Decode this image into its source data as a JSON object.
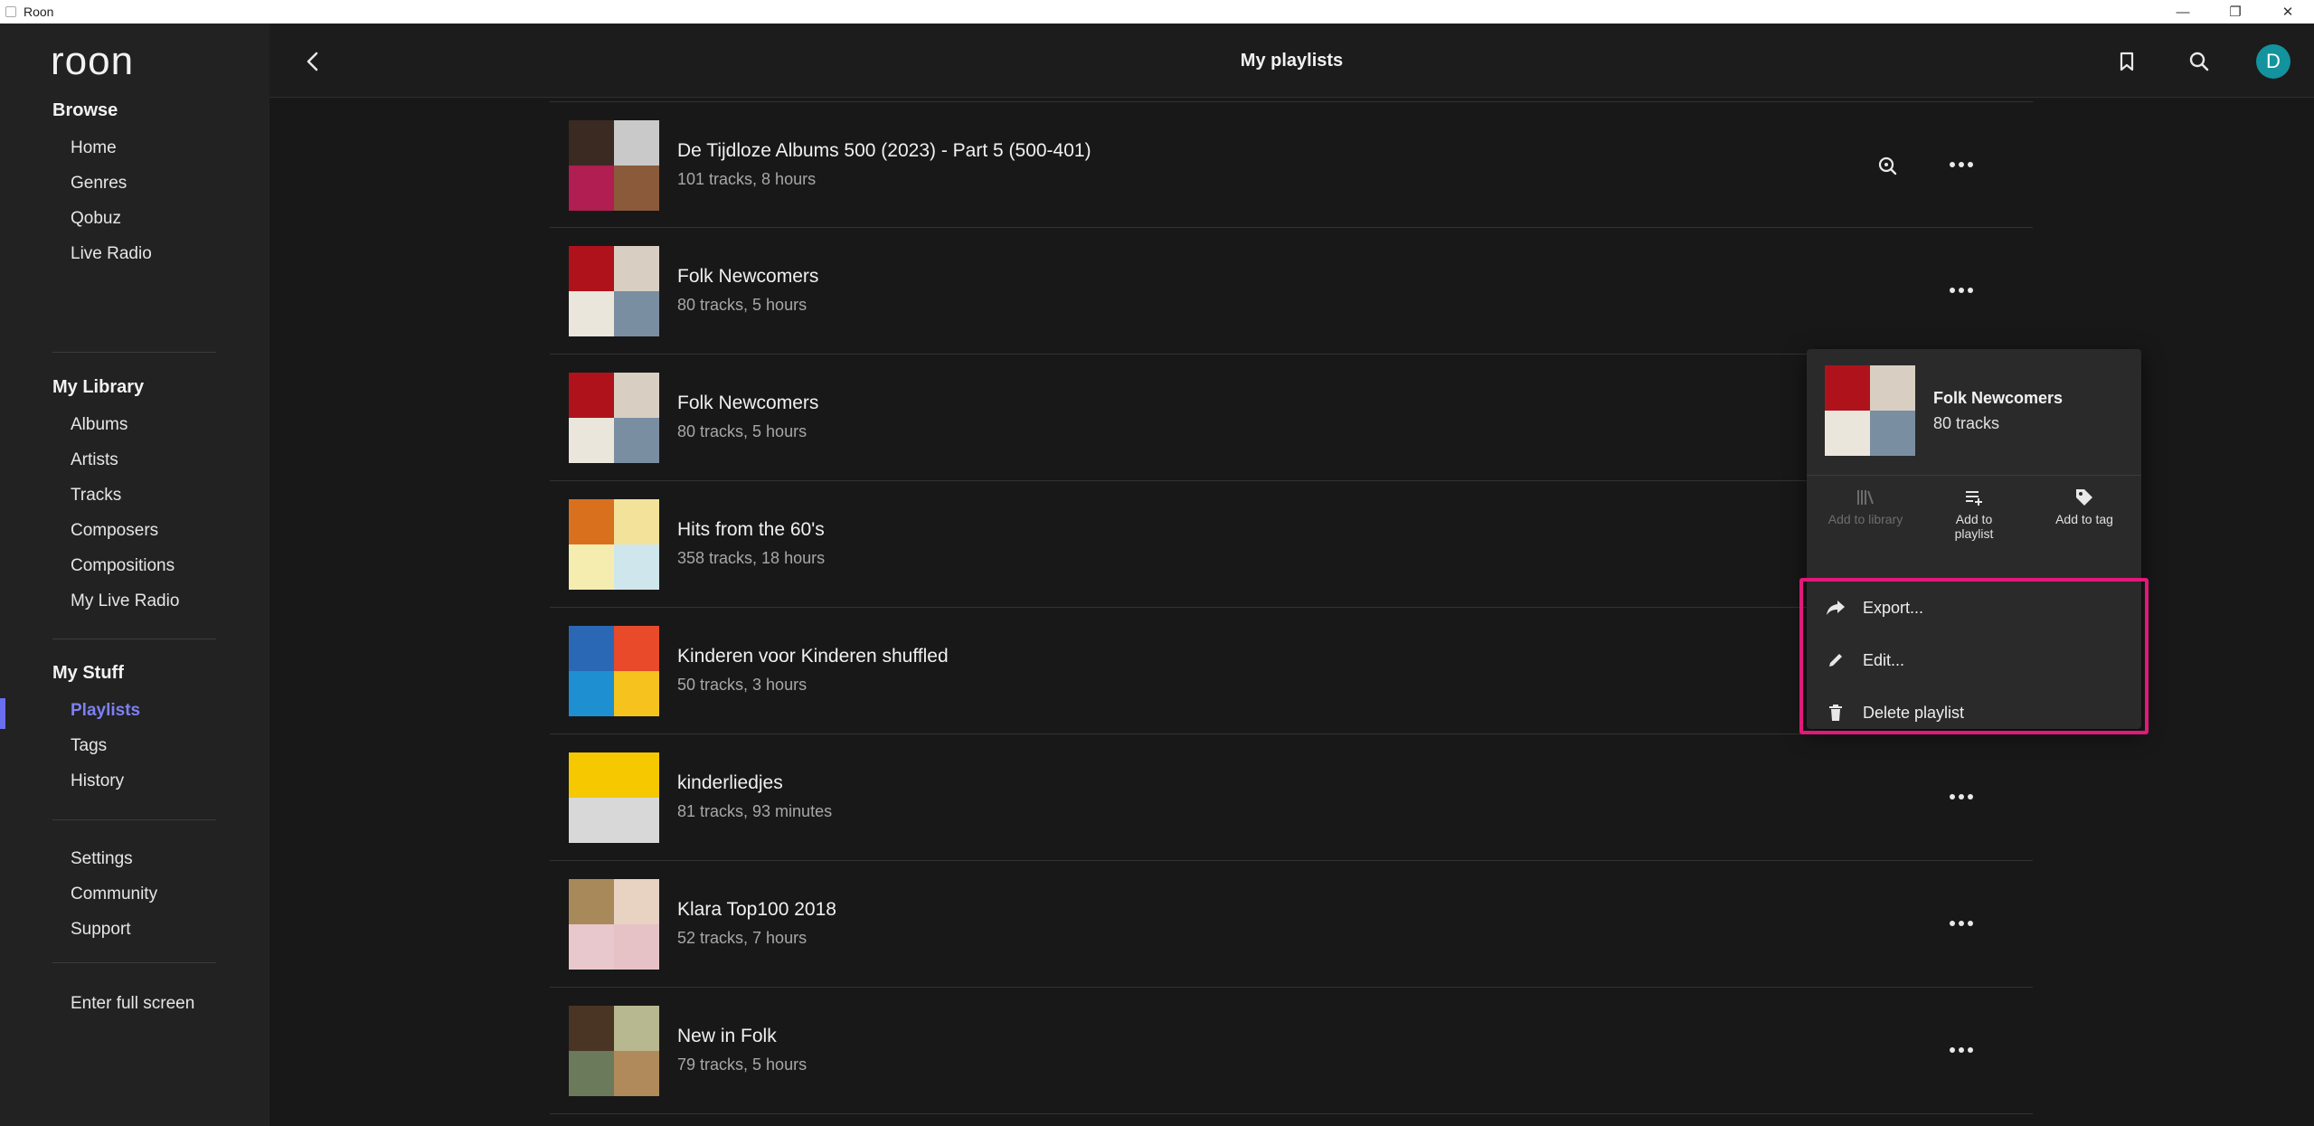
{
  "window": {
    "title": "Roon",
    "minimize": "—",
    "restore": "❐",
    "close": "✕"
  },
  "logo_text": "roon",
  "sidebar": {
    "browse": {
      "heading": "Browse",
      "items": [
        "Home",
        "Genres",
        "Qobuz",
        "Live Radio"
      ]
    },
    "library": {
      "heading": "My Library",
      "items": [
        "Albums",
        "Artists",
        "Tracks",
        "Composers",
        "Compositions",
        "My Live Radio"
      ]
    },
    "stuff": {
      "heading": "My Stuff",
      "items": [
        "Playlists",
        "Tags",
        "History"
      ],
      "active": "Playlists"
    },
    "misc": {
      "items": [
        "Settings",
        "Community",
        "Support"
      ]
    },
    "fullscreen": "Enter full screen"
  },
  "header": {
    "title": "My playlists",
    "avatar_letter": "D",
    "icons": [
      "back-icon",
      "bookmark-icon",
      "search-icon"
    ]
  },
  "playlists": [
    {
      "title": "De Tijdloze Albums 500 (2023) - Part 5  (500-401)",
      "subtitle": "101 tracks, 8 hours",
      "colors": [
        "#3a2a22",
        "#c9c9c9",
        "#b01e52",
        "#8a5a3a"
      ],
      "focus_icon": true
    },
    {
      "title": "Folk Newcomers",
      "subtitle": "80 tracks, 5 hours",
      "colors": [
        "#b0121c",
        "#d8cfc2",
        "#eae6dc",
        "#7a8ea2"
      ]
    },
    {
      "title": "Folk Newcomers",
      "subtitle": "80 tracks, 5 hours",
      "colors": [
        "#b0121c",
        "#d8cfc2",
        "#eae6dc",
        "#7a8ea2"
      ]
    },
    {
      "title": "Hits from the 60's",
      "subtitle": "358 tracks, 18 hours",
      "colors": [
        "#d9701e",
        "#f2e29a",
        "#f5ecb0",
        "#cfe7ec"
      ]
    },
    {
      "title": "Kinderen voor Kinderen shuffled",
      "subtitle": "50 tracks, 3 hours",
      "colors": [
        "#2a68b5",
        "#e84a2a",
        "#1e8fd0",
        "#f5c21e"
      ]
    },
    {
      "title": "kinderliedjes",
      "subtitle": "81 tracks, 93 minutes",
      "colors": [
        "#f5c800",
        "#f5c800",
        "#d8d8d8",
        "#d8d8d8"
      ]
    },
    {
      "title": "Klara Top100 2018",
      "subtitle": "52 tracks, 7 hours",
      "colors": [
        "#a88a5a",
        "#e8d2c2",
        "#e8c8cc",
        "#e6c2c6"
      ]
    },
    {
      "title": "New in Folk",
      "subtitle": "79 tracks, 5 hours",
      "colors": [
        "#4a3424",
        "#b8b890",
        "#6a7a5a",
        "#b08a5a"
      ]
    }
  ],
  "context_menu": {
    "title": "Folk Newcomers",
    "subtitle": "80 tracks",
    "colors": [
      "#b0121c",
      "#d8cfc2",
      "#eae6dc",
      "#7a8ea2"
    ],
    "actions": [
      {
        "label": "Add to library",
        "icon": "library-icon",
        "enabled": false
      },
      {
        "label": "Add to playlist",
        "icon": "add-to-playlist-icon",
        "enabled": true
      },
      {
        "label": "Add to tag",
        "icon": "tag-icon",
        "enabled": true
      }
    ],
    "options": [
      {
        "label": "Export...",
        "icon": "share-icon"
      },
      {
        "label": "Edit...",
        "icon": "pencil-icon"
      },
      {
        "label": "Delete playlist",
        "icon": "trash-icon"
      }
    ],
    "highlight_color": "#e2197a"
  },
  "accent": "#7d80f5"
}
